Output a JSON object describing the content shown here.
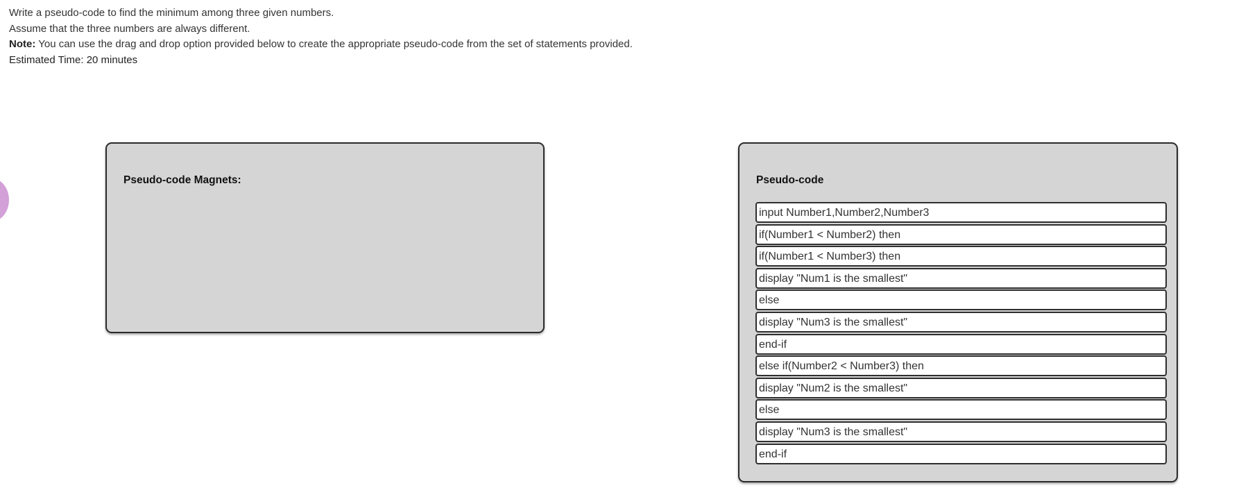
{
  "instructions": {
    "line1": "Write a pseudo-code to find the minimum among three given numbers.",
    "line2": "Assume that the three numbers are always different.",
    "note_label": "Note:",
    "note_text": " You can use the drag and drop option provided below to create the appropriate pseudo-code from the set of statements provided.",
    "estimated_time": "Estimated Time: 20 minutes"
  },
  "magnets_panel": {
    "title": "Pseudo-code Magnets:"
  },
  "code_panel": {
    "title": "Pseudo-code",
    "lines": [
      "input Number1,Number2,Number3",
      "if(Number1 < Number2) then",
      "if(Number1 < Number3) then",
      "display \"Num1 is the smallest\"",
      "else",
      "display \"Num3 is the smallest\"",
      "end-if",
      "else if(Number2 < Number3) then",
      "display \"Num2 is the smallest\"",
      "else",
      "display \"Num3 is the smallest\"",
      "end-if"
    ]
  },
  "colors": {
    "panel_background": "#d5d5d5",
    "panel_border": "#2b2b2b",
    "drag_handle": "#d3a0d8"
  }
}
